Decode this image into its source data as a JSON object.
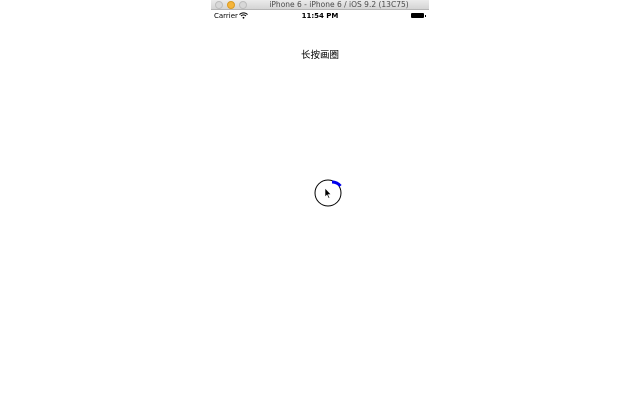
{
  "simulator": {
    "window_title": "iPhone 6 - iPhone 6 / iOS 9.2 (13C75)"
  },
  "status_bar": {
    "carrier": "Carrier",
    "time": "11:54 PM",
    "wifi_icon": "wifi-icon",
    "battery_icon": "battery-icon"
  },
  "screen": {
    "title": "长按画圈"
  },
  "progress_ring": {
    "progress_fraction": 0.14,
    "track_color": "#000000",
    "progress_color": "#0000ee"
  },
  "cursor": {
    "icon": "mouse-pointer-icon"
  }
}
